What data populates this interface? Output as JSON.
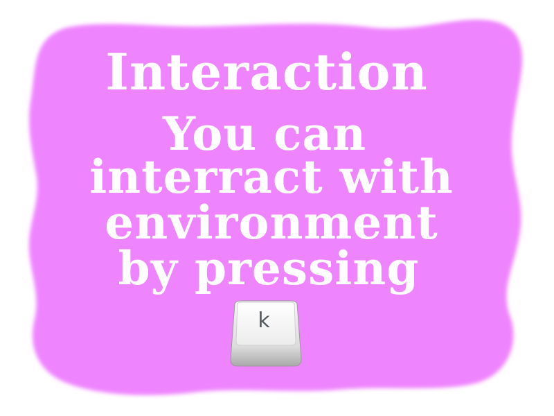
{
  "panel": {
    "background_color": "#ef84ff",
    "text_color": "#ffffff"
  },
  "message": {
    "title": "Interaction",
    "lines": [
      "You can",
      "interract with",
      "environment",
      "by pressing"
    ]
  },
  "key": {
    "label": "k",
    "icon": "keyboard-key-icon"
  }
}
